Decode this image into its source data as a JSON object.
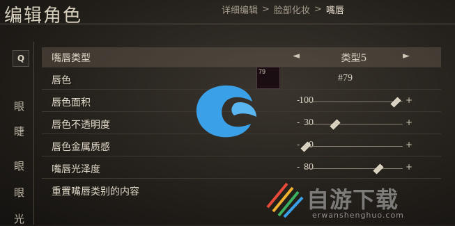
{
  "header": {
    "title": "编辑角色",
    "breadcrumb": [
      "详细编辑",
      ">",
      "脸部化妆",
      ">",
      "嘴唇"
    ]
  },
  "left_tabs": {
    "search_icon": "Q",
    "items": [
      "眼",
      "睫",
      "眼",
      "眼",
      "光"
    ]
  },
  "rows": [
    {
      "label": "嘴唇类型",
      "value": "类型5",
      "type": "selector",
      "left_arrow": "◄",
      "right_arrow": "►"
    },
    {
      "label": "唇色",
      "value": "#79",
      "swatch_label": "79",
      "swatch_color": "#1a0e12",
      "type": "color"
    },
    {
      "label": "唇色面积",
      "value": "100",
      "type": "slider",
      "level": 0.92
    },
    {
      "label": "唇色不透明度",
      "value": "30",
      "type": "slider",
      "level": 0.3
    },
    {
      "label": "唇色金属质感",
      "value": "0",
      "type": "slider",
      "level": 0.0
    },
    {
      "label": "嘴唇光泽度",
      "value": "80",
      "type": "slider",
      "level": 0.74
    },
    {
      "label": "重置嘴唇类别的内容",
      "type": "action"
    }
  ],
  "slider_controls": {
    "minus": "-",
    "plus": "+"
  },
  "watermark": {
    "text": "自游下载",
    "sub": "erwanshenghuo.com",
    "logo_color": "#3aa0e8"
  }
}
